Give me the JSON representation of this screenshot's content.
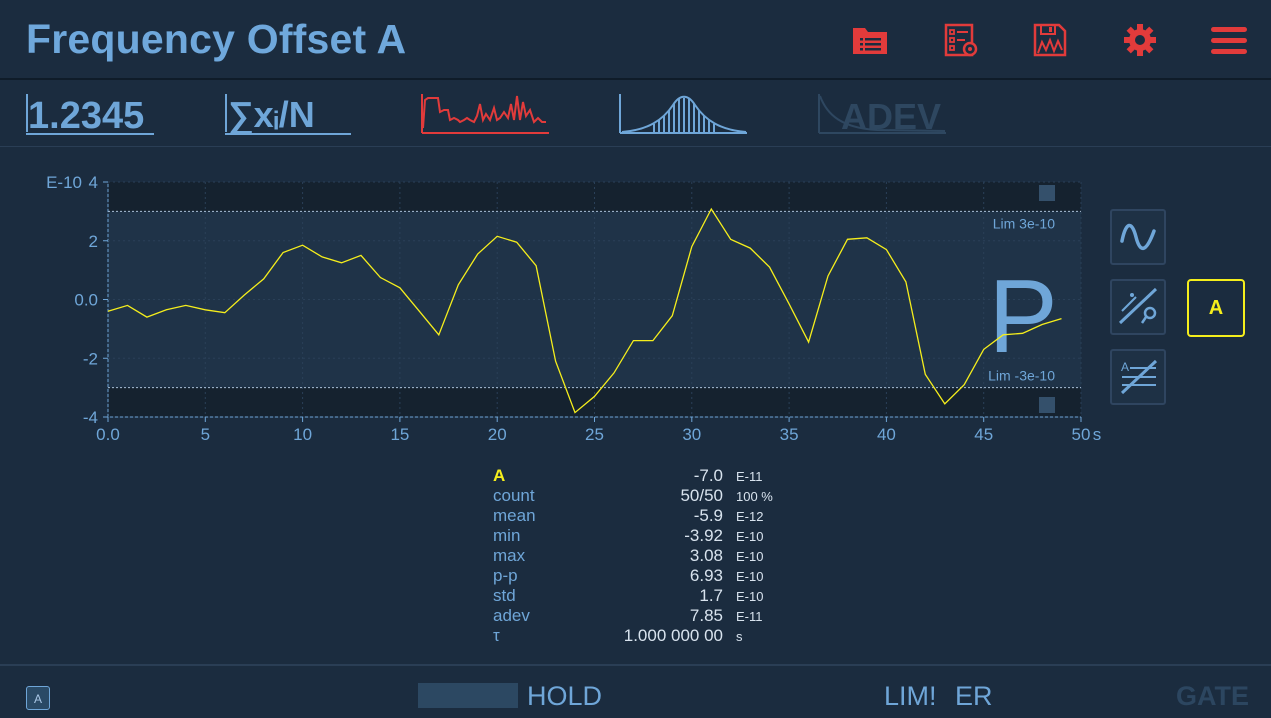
{
  "header": {
    "title": "Frequency Offset A",
    "icons": [
      "folder-list-icon",
      "checklist-settings-icon",
      "save-chart-icon",
      "gear-icon",
      "hamburger-menu-icon"
    ],
    "accent": "#e23b3b"
  },
  "toolbar": {
    "numeric_label": "1.2345",
    "stats_label": "∑xᵢ/N",
    "adev_label": "ADEV"
  },
  "chart_data": {
    "type": "line",
    "exponent_label": "E-10",
    "x_unit": "s",
    "xlim": [
      0,
      50
    ],
    "ylim": [
      -4,
      4
    ],
    "x_ticks": [
      "0.0",
      "5",
      "10",
      "15",
      "20",
      "25",
      "30",
      "35",
      "40",
      "45",
      "50"
    ],
    "y_ticks": [
      "4",
      "2",
      "0.0",
      "-2",
      "-4"
    ],
    "grid": true,
    "limits": {
      "upper": 3,
      "lower": -3,
      "upper_label": "Lim 3e-10",
      "lower_label": "Lim -3e-10"
    },
    "mode_letter": "P",
    "series": [
      {
        "color": "#f5ee1c",
        "x": [
          0,
          1,
          2,
          3,
          4,
          5,
          6,
          7,
          8,
          9,
          10,
          11,
          12,
          13,
          14,
          15,
          16,
          17,
          18,
          19,
          20,
          21,
          22,
          23,
          24,
          25,
          26,
          27,
          28,
          29,
          30,
          31,
          32,
          33,
          34,
          35,
          36,
          37,
          38,
          39,
          40,
          41,
          42,
          43,
          44,
          45,
          46,
          47,
          48,
          49
        ],
        "y": [
          -0.4,
          -0.2,
          -0.6,
          -0.35,
          -0.2,
          -0.35,
          -0.45,
          0.15,
          0.7,
          1.6,
          1.85,
          1.45,
          1.25,
          1.5,
          0.75,
          0.4,
          -0.4,
          -1.2,
          0.5,
          1.55,
          2.15,
          1.95,
          1.15,
          -2.1,
          -3.85,
          -3.3,
          -2.5,
          -1.4,
          -1.4,
          -0.55,
          1.8,
          3.08,
          2.05,
          1.75,
          1.1,
          -0.15,
          -1.45,
          0.8,
          2.05,
          2.1,
          1.7,
          0.6,
          -2.55,
          -3.55,
          -2.9,
          -1.7,
          -1.2,
          -1.15,
          -0.85,
          -0.65
        ]
      }
    ]
  },
  "side_buttons": [
    "sine-wave-icon",
    "trend-remove-icon",
    "slope-lines-icon"
  ],
  "channel_button": "A",
  "stats": {
    "rows": [
      {
        "label": "A",
        "value": "-7.0",
        "unit": "E-11"
      },
      {
        "label": "count",
        "value": "50/50",
        "unit": "100 %"
      },
      {
        "label": "mean",
        "value": "-5.9",
        "unit": "E-12"
      },
      {
        "label": "min",
        "value": "-3.92",
        "unit": "E-10"
      },
      {
        "label": "max",
        "value": "3.08",
        "unit": "E-10"
      },
      {
        "label": "p-p",
        "value": "6.93",
        "unit": "E-10"
      },
      {
        "label": "std",
        "value": "1.7",
        "unit": "E-10"
      },
      {
        "label": "adev",
        "value": "7.85",
        "unit": "E-11"
      },
      {
        "label": "τ",
        "value": "1.000 000 00",
        "unit": "s"
      }
    ]
  },
  "footer": {
    "channel_badge": "A",
    "hold_label": "HOLD",
    "lim_label": "LIM!",
    "er_label": "ER",
    "gate_label": "GATE"
  },
  "colors": {
    "background": "#1b2c3f",
    "text": "#6fa6d8",
    "trace": "#f5ee1c",
    "accent": "#e23b3b"
  }
}
